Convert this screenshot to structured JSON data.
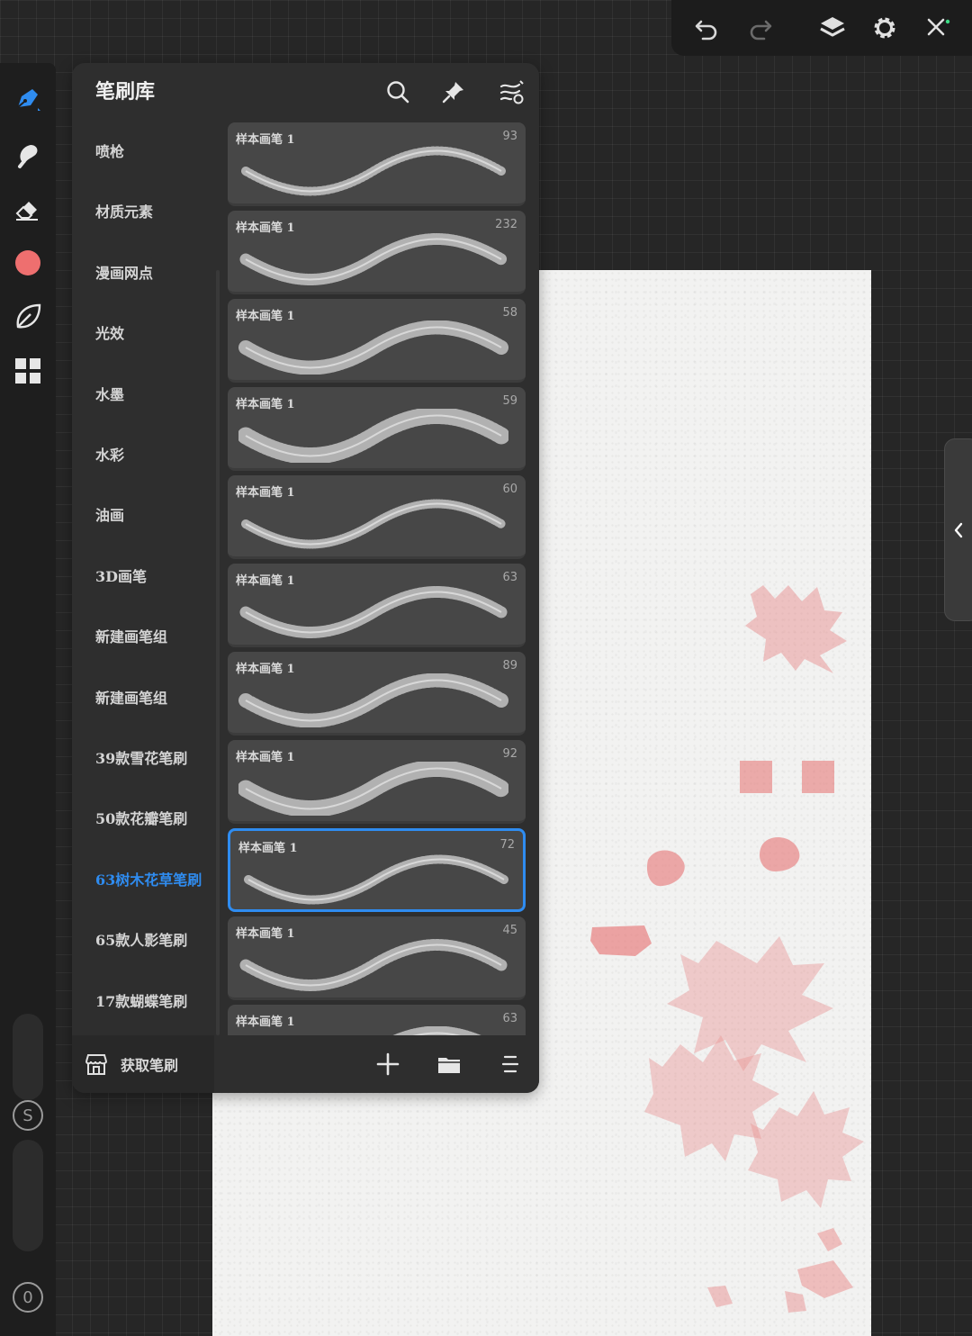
{
  "top_toolbar": {
    "icons": [
      "undo-icon",
      "redo-icon",
      "layers-icon",
      "settings-icon",
      "close-icon"
    ]
  },
  "left_toolbar": {
    "tools": [
      "brush-icon",
      "smudge-icon",
      "eraser-icon",
      "color-icon",
      "leaf-icon",
      "grid-icon"
    ],
    "active_color": "#ee6f6f",
    "size_label": "S",
    "opacity_label": "0"
  },
  "panel": {
    "title": "笔刷库",
    "categories": [
      "喷枪",
      "材质元素",
      "漫画网点",
      "光效",
      "水墨",
      "水彩",
      "油画",
      "3D画笔",
      "新建画笔组",
      "新建画笔组",
      "39款雪花笔刷",
      "50款花瓣笔刷",
      "63树木花草笔刷",
      "65款人影笔刷",
      "17款蝴蝶笔刷"
    ],
    "active_category_index": 12,
    "brushes": [
      {
        "name": "样本画笔 1",
        "count": "93"
      },
      {
        "name": "样本画笔 1",
        "count": "232"
      },
      {
        "name": "样本画笔 1",
        "count": "58"
      },
      {
        "name": "样本画笔 1",
        "count": "59"
      },
      {
        "name": "样本画笔 1",
        "count": "60"
      },
      {
        "name": "样本画笔 1",
        "count": "63"
      },
      {
        "name": "样本画笔 1",
        "count": "89"
      },
      {
        "name": "样本画笔 1",
        "count": "92"
      },
      {
        "name": "样本画笔 1",
        "count": "72"
      },
      {
        "name": "样本画笔 1",
        "count": "45"
      },
      {
        "name": "样本画笔 1",
        "count": "63"
      }
    ],
    "selected_brush_index": 8,
    "footer": {
      "get_brushes_label": "获取笔刷"
    }
  },
  "colors": {
    "accent": "#2f8cf0",
    "stamp": "#e77b7b"
  }
}
